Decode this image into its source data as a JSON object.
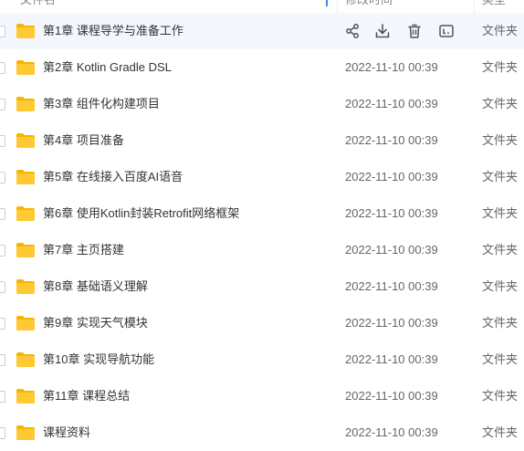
{
  "header": {
    "name_label": "文件名",
    "time_label": "修改时间",
    "type_label": "类型"
  },
  "rows": [
    {
      "name": "第1章 课程导学与准备工作",
      "time": "",
      "type": "文件夹",
      "hover": true
    },
    {
      "name": "第2章 Kotlin Gradle DSL",
      "time": "2022-11-10 00:39",
      "type": "文件夹"
    },
    {
      "name": "第3章 组件化构建项目",
      "time": "2022-11-10 00:39",
      "type": "文件夹"
    },
    {
      "name": "第4章 项目准备",
      "time": "2022-11-10 00:39",
      "type": "文件夹"
    },
    {
      "name": "第5章 在线接入百度AI语音",
      "time": "2022-11-10 00:39",
      "type": "文件夹"
    },
    {
      "name": "第6章 使用Kotlin封装Retrofit网络框架",
      "time": "2022-11-10 00:39",
      "type": "文件夹"
    },
    {
      "name": "第7章 主页搭建",
      "time": "2022-11-10 00:39",
      "type": "文件夹"
    },
    {
      "name": "第8章 基础语义理解",
      "time": "2022-11-10 00:39",
      "type": "文件夹"
    },
    {
      "name": "第9章 实现天气模块",
      "time": "2022-11-10 00:39",
      "type": "文件夹"
    },
    {
      "name": "第10章 实现导航功能",
      "time": "2022-11-10 00:39",
      "type": "文件夹"
    },
    {
      "name": "第11章 课程总结",
      "time": "2022-11-10 00:39",
      "type": "文件夹"
    },
    {
      "name": "课程资料",
      "time": "2022-11-10 00:39",
      "type": "文件夹"
    }
  ],
  "row_actions": [
    "share-icon",
    "download-icon",
    "delete-icon",
    "more-icon"
  ],
  "colors": {
    "folder": "#ffc933",
    "folder_tab": "#f7b500",
    "accent": "#3b8cff",
    "hover_bg": "#f4f7fd",
    "icon": "#555555"
  }
}
